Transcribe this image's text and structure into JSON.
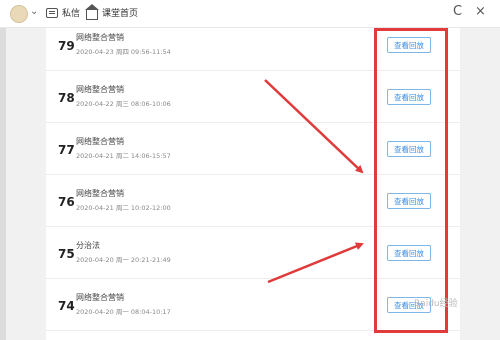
{
  "header": {
    "messages_label": "私信",
    "homepage_label": "课堂首页",
    "refresh_glyph": "C",
    "close_glyph": "×"
  },
  "sessions": [
    {
      "num": "79",
      "title": "网络整合营销",
      "time": "2020-04-23 周四 09:56-11:54",
      "button": "查看回放"
    },
    {
      "num": "78",
      "title": "网络整合营销",
      "time": "2020-04-22 周三 08:06-10:06",
      "button": "查看回放"
    },
    {
      "num": "77",
      "title": "网络整合营销",
      "time": "2020-04-21 周二 14:06-15:57",
      "button": "查看回放"
    },
    {
      "num": "76",
      "title": "网络整合营销",
      "time": "2020-04-21 周二 10:02-12:00",
      "button": "查看回放"
    },
    {
      "num": "75",
      "title": "分治法",
      "time": "2020-04-20 周一 20:21-21:49",
      "button": "查看回放"
    },
    {
      "num": "74",
      "title": "网络整合营销",
      "time": "2020-04-20 周一 08:04-10:17",
      "button": "查看回放"
    }
  ],
  "watermark": "Baidu经验",
  "colors": {
    "highlight": "#e03a3a",
    "button_text": "#3a8ee6"
  }
}
